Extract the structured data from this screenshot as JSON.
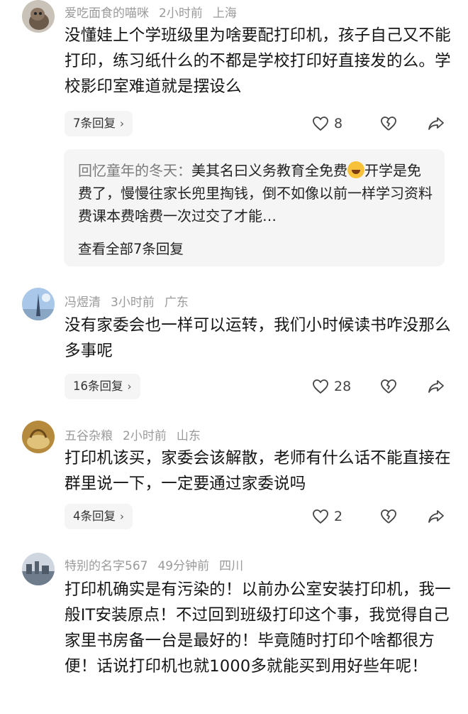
{
  "comments": [
    {
      "user": "爱吃面食的喵咪",
      "time": "2小时前",
      "location": "上海",
      "text": "没懂娃上个学班级里为啥要配打印机，孩子自己又不能打印，练习纸什么的不都是学校打印好直接发的么。学校影印室难道就是摆设么",
      "replies_label": "7条回复",
      "likes": "8",
      "quoted_reply": {
        "author": "回忆童年的冬天：",
        "text_before_emoji": "美其名曰义务教育全免费",
        "text_after_emoji": "开学是免费了，慢慢往家长兜里掏钱，倒不如像以前一样学习资料费课本费啥费一次过交了才能…",
        "view_all_label": "查看全部7条回复"
      },
      "avatar_icon": "cat-avatar"
    },
    {
      "user": "冯煜清",
      "time": "3小时前",
      "location": "广东",
      "text": "没有家委会也一样可以运转，我们小时候读书咋没那么多事呢",
      "replies_label": "16条回复",
      "likes": "28",
      "avatar_icon": "tower-sky-avatar"
    },
    {
      "user": "五谷杂粮",
      "time": "2小时前",
      "location": "山东",
      "text": "打印机该买，家委会该解散，老师有什么话不能直接在群里说一下，一定要通过家委说吗",
      "replies_label": "4条回复",
      "likes": "2",
      "avatar_icon": "grain-avatar"
    },
    {
      "user": "特别的名字567",
      "time": "49分钟前",
      "location": "四川",
      "text": "打印机确实是有污染的！以前办公室安装打印机，我一般IT安装原点！不过回到班级打印这个事，我觉得自己家里书房备一台是最好的！毕竟随时打印个啥都很方便！话说打印机也就1000多就能买到用好些年呢！",
      "avatar_icon": "city-avatar"
    }
  ],
  "icons": [
    "heart-icon",
    "broken-heart-icon",
    "share-icon",
    "chevron-right-icon"
  ],
  "colors": {
    "meta_gray": "#9a9a9a",
    "pill_bg": "#f5f5f5"
  }
}
